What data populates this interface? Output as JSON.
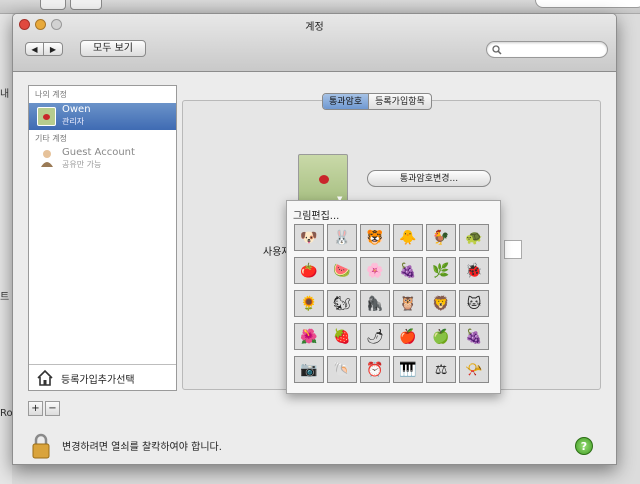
{
  "window": {
    "title": "계정"
  },
  "toolbar": {
    "back": "◀",
    "forward": "▶",
    "show_all": "모두 보기",
    "search_placeholder": ""
  },
  "background_app": {
    "side_texts": [
      "내",
      "트",
      "Ro"
    ]
  },
  "sidebar": {
    "my_account_header": "나의 계정",
    "my_account": {
      "name": "Owen",
      "role": "관리자"
    },
    "other_accounts_header": "기타 계정",
    "other_account": {
      "name": "Guest Account",
      "role": "공유만 가능"
    },
    "add_account_label": "등록가입추가선택",
    "add_button": "+",
    "remove_button": "−"
  },
  "tabs": [
    {
      "label": "통과암호",
      "selected": true
    },
    {
      "label": "등록가입항목",
      "selected": false
    }
  ],
  "panel": {
    "change_password_button": "통과암호변경...",
    "name_label": "사용자"
  },
  "picture_popup": {
    "edit_label": "그림편집...",
    "pictures": [
      "dog-icon",
      "rabbit-icon",
      "tiger-icon",
      "chick-icon",
      "rooster-icon",
      "turtle-icon",
      "tomato-icon",
      "watermelon-icon",
      "flower-icon",
      "grapes-green-icon",
      "leaf-icon",
      "ladybug-icon",
      "sunflower-icon",
      "squirrel-icon",
      "gorilla-icon",
      "owl-icon",
      "lion-icon",
      "cat-icon",
      "pink-flower-icon",
      "strawberry-icon",
      "chili-icon",
      "apple-icon",
      "green-apple-icon",
      "grapes-purple-icon",
      "camera-icon",
      "shell-icon",
      "clock-icon",
      "piano-icon",
      "scale-icon",
      "gramophone-icon"
    ],
    "glyphs": [
      "🐶",
      "🐰",
      "🐯",
      "🐥",
      "🐓",
      "🐢",
      "🍅",
      "🍉",
      "🌸",
      "🍇",
      "🌿",
      "🐞",
      "🌻",
      "🐿",
      "🦍",
      "🦉",
      "🦁",
      "🐱",
      "🌺",
      "🍓",
      "🌶",
      "🍎",
      "🍏",
      "🍇",
      "📷",
      "🐚",
      "⏰",
      "🎹",
      "⚖",
      "📯"
    ]
  },
  "footer": {
    "lock_text": "변경하려면 열쇠를 찰칵하여야 합니다.",
    "help": "?"
  },
  "colors": {
    "selection": "#3f6bb3",
    "help": "#3d9a1f",
    "close": "#e0493f",
    "minimize": "#e8a93a"
  }
}
